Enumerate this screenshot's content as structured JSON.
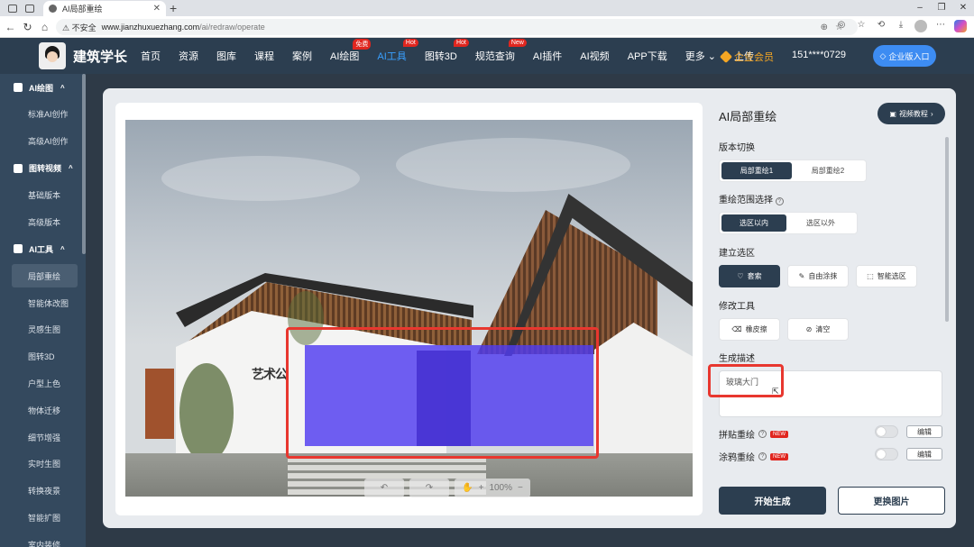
{
  "browser": {
    "tab_title": "AI局部重绘",
    "close": "✕",
    "new_tab": "+",
    "security": "不安全",
    "url_host": "www.jianzhuxuezhang.com",
    "url_path": "/ai/redraw/operate",
    "win_min": "–",
    "win_max": "❐",
    "win_close": "✕"
  },
  "header": {
    "brand": "建筑学长",
    "menu": [
      {
        "label": "首页",
        "badge": ""
      },
      {
        "label": "资源",
        "badge": ""
      },
      {
        "label": "图库",
        "badge": ""
      },
      {
        "label": "课程",
        "badge": ""
      },
      {
        "label": "案例",
        "badge": ""
      },
      {
        "label": "AI绘图",
        "badge": "免费"
      },
      {
        "label": "AI工具",
        "badge": "Hot"
      },
      {
        "label": "图转3D",
        "badge": "Hot"
      },
      {
        "label": "规范查询",
        "badge": "New"
      },
      {
        "label": "AI插件",
        "badge": ""
      },
      {
        "label": "AI视频",
        "badge": ""
      },
      {
        "label": "APP下载",
        "badge": ""
      },
      {
        "label": "更多",
        "badge": ""
      },
      {
        "label": "上传",
        "badge": ""
      }
    ],
    "more_chevron": "⌄",
    "vip_label": "企业会员",
    "phone": "151****0729",
    "enterprise_btn": "企业版入口"
  },
  "sidebar": {
    "groups": [
      {
        "label": "AI绘图",
        "items": [
          "标准AI创作",
          "高级AI创作"
        ]
      },
      {
        "label": "图转视频",
        "items": [
          "基础版本",
          "高级版本"
        ]
      },
      {
        "label": "AI工具",
        "items": [
          "局部重绘",
          "智能体改图",
          "灵感生图",
          "图转3D",
          "户型上色",
          "物体迁移",
          "细节增强",
          "实时生图",
          "转换夜景",
          "智能扩图",
          "室内装修"
        ]
      }
    ],
    "chevron": "^",
    "active_item": "局部重绘"
  },
  "canvas": {
    "photo_sign": "艺术公",
    "zoom": "100%",
    "undo": "↶",
    "redo": "↷",
    "hand": "✋",
    "plus": "+",
    "minus": "−"
  },
  "right_panel": {
    "title": "AI局部重绘",
    "video_btn": "视频教程",
    "version_label": "版本切换",
    "versions": [
      "局部重绘1",
      "局部重绘2"
    ],
    "range_label": "重绘范围选择",
    "ranges": [
      "选区以内",
      "选区以外"
    ],
    "select_label": "建立选区",
    "select_tools": [
      "套索",
      "自由涂抹",
      "智能选区"
    ],
    "modify_label": "修改工具",
    "modify_tools": [
      "橡皮擦",
      "清空"
    ],
    "desc_label": "生成描述",
    "desc_value": "玻璃大门",
    "option1": "拼贴重绘",
    "option2": "涂鸦重绘",
    "new_badge": "NEW",
    "edit_label": "编辑",
    "generate_btn": "开始生成",
    "change_btn": "更换图片"
  }
}
